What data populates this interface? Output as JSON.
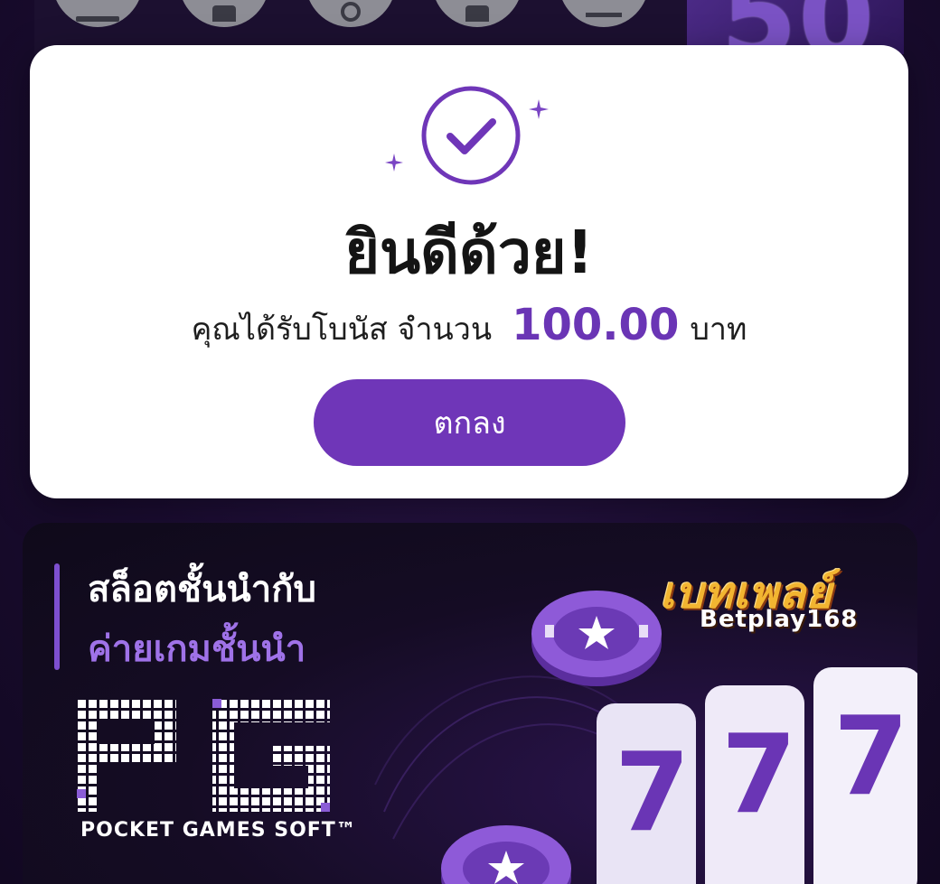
{
  "top": {
    "icons": [
      "category-icon",
      "card-icon",
      "support-icon",
      "profile-icon",
      "bonus-icon"
    ],
    "promo_number": "50"
  },
  "modal": {
    "title": "ยินดีด้วย!",
    "message_prefix": "คุณได้รับโบนัส จำนวน",
    "amount": "100.00",
    "currency": "บาท",
    "ok_label": "ตกลง",
    "accent_color": "#6f36b8"
  },
  "banner": {
    "line1": "สล็อตชั้นนำกับ",
    "line2": "ค่ายเกมชั้นนำ",
    "provider_tagline": "POCKET GAMES SOFT™",
    "brand_thai": "เบทเพลย์",
    "brand_en": "Betplay168",
    "reel_symbol": "7"
  }
}
